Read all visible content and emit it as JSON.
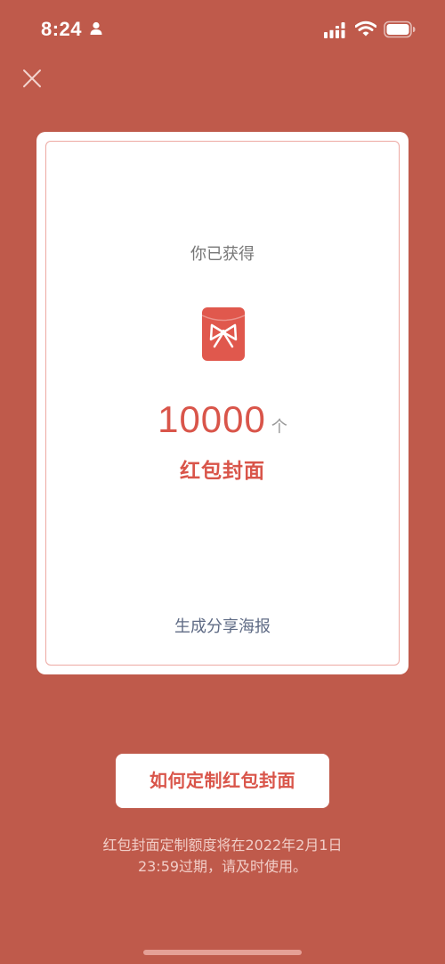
{
  "status_bar": {
    "time": "8:24"
  },
  "card": {
    "obtained_label": "你已获得",
    "count": "10000",
    "unit": "个",
    "item_name": "红包封面",
    "share_label": "生成分享海报"
  },
  "how_button_label": "如何定制红包封面",
  "note": {
    "line1": "红包封面定制额度将在2022年2月1日",
    "line2": "23:59过期，请及时使用。"
  },
  "colors": {
    "background": "#BF5A4B",
    "accent": "#D9554A",
    "share_text": "#5F6B85"
  },
  "icons": [
    "person-icon",
    "signal-icon",
    "wifi-icon",
    "battery-icon",
    "close-icon",
    "red-envelope-icon"
  ]
}
